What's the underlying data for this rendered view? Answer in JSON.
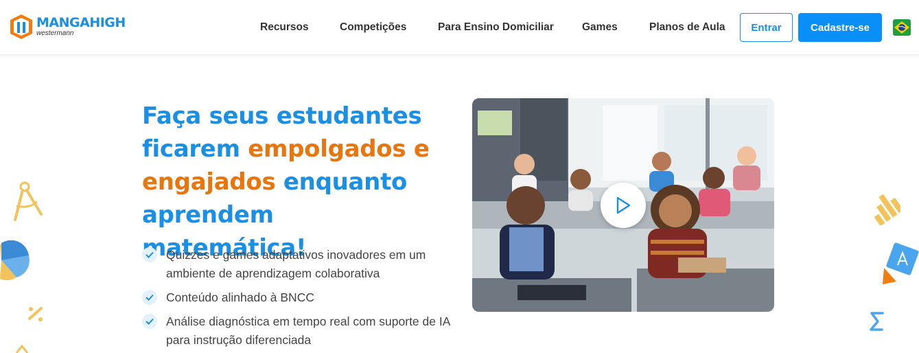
{
  "header": {
    "logo_name": "MANGAHIGH",
    "logo_sub": "westermann",
    "nav": [
      "Recursos",
      "Competições",
      "Para Ensino Domiciliar",
      "Games",
      "Planos de Aula"
    ],
    "login_label": "Entrar",
    "signup_label": "Cadastre-se",
    "flag_icon": "brazil-flag-icon"
  },
  "hero": {
    "title_parts": [
      "Faça seus estudantes ficarem ",
      "empolgados e engajados",
      " enquanto aprendem matemática!"
    ],
    "bullets": [
      "Quizzes e games adaptativos inovadores em um ambiente de aprendizagem colaborativa",
      "Conteúdo alinhado à BNCC",
      "Análise diagnóstica em tempo real com suporte de IA para instrução diferenciada"
    ]
  },
  "video": {
    "play_icon": "play-icon",
    "thumbnail": "classroom-students-photo"
  },
  "colors": {
    "brand_blue": "#1a8fe3",
    "button_blue": "#0a8ff8",
    "accent_orange": "#e8760f"
  }
}
